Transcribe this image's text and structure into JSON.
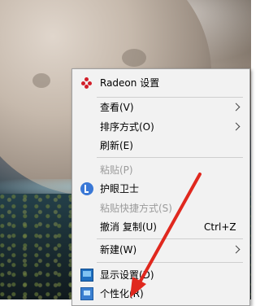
{
  "context_menu": {
    "items": [
      {
        "label": "Radeon 设置",
        "icon": "radeon-icon"
      },
      {
        "label": "查看(V)",
        "submenu": true
      },
      {
        "label": "排序方式(O)",
        "submenu": true
      },
      {
        "label": "刷新(E)"
      },
      {
        "label": "粘贴(P)",
        "disabled": true
      },
      {
        "label": "护眼卫士",
        "icon": "eye-guard-icon"
      },
      {
        "label": "粘贴快捷方式(S)",
        "disabled": true
      },
      {
        "label": "撤消 复制(U)",
        "shortcut": "Ctrl+Z"
      },
      {
        "label": "新建(W)",
        "submenu": true
      },
      {
        "label": "显示设置(D)",
        "icon": "display-settings-icon"
      },
      {
        "label": "个性化(R)",
        "icon": "personalize-icon"
      }
    ]
  },
  "annotation": {
    "color": "#e0281e",
    "points_to": "个性化(R)"
  }
}
